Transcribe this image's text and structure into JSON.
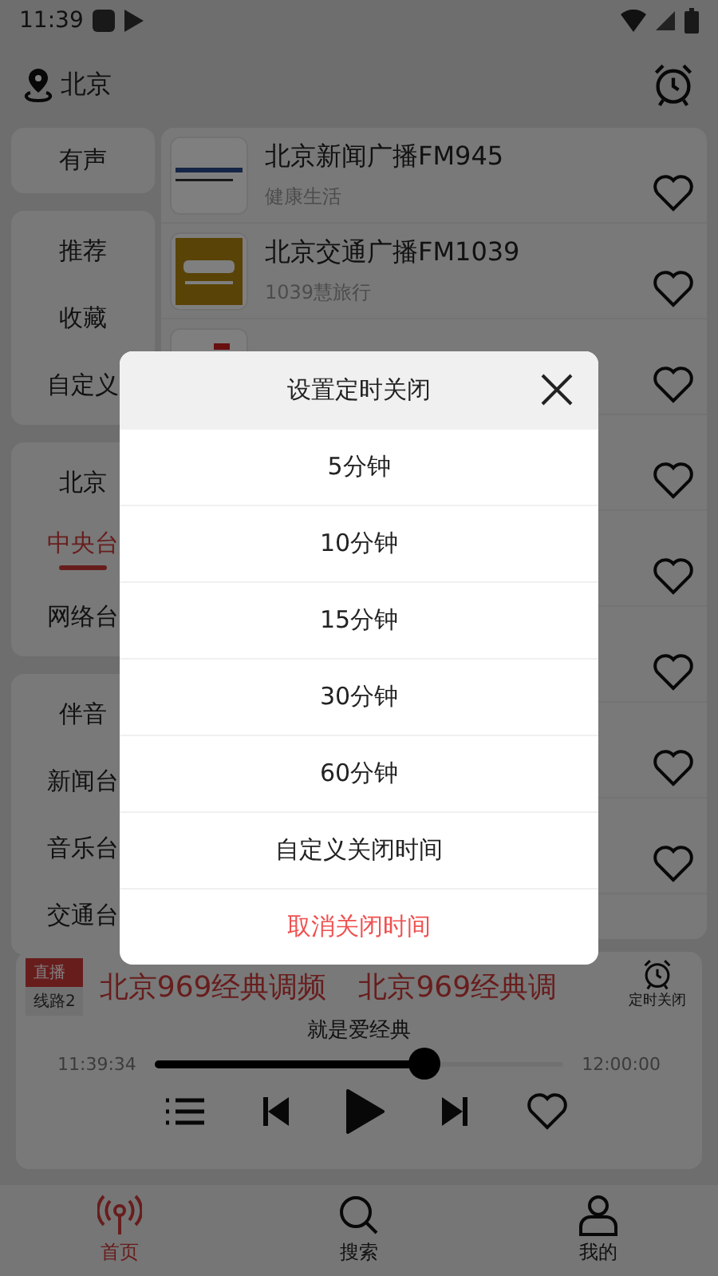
{
  "status_bar": {
    "time": "11:39"
  },
  "header": {
    "location": "北京"
  },
  "sidebar": {
    "groups": [
      {
        "items": [
          {
            "label": "有声",
            "selected": false
          }
        ]
      },
      {
        "items": [
          {
            "label": "推荐",
            "selected": false
          },
          {
            "label": "收藏",
            "selected": false
          },
          {
            "label": "自定义",
            "selected": false
          }
        ]
      },
      {
        "items": [
          {
            "label": "北京",
            "selected": false
          },
          {
            "label": "中央台",
            "selected": true
          },
          {
            "label": "网络台",
            "selected": false
          }
        ]
      },
      {
        "items": [
          {
            "label": "伴音",
            "selected": false
          },
          {
            "label": "新闻台",
            "selected": false
          },
          {
            "label": "音乐台",
            "selected": false
          },
          {
            "label": "交通台",
            "selected": false
          }
        ]
      }
    ]
  },
  "stations": [
    {
      "kind": "station",
      "name": "北京新闻广播FM945",
      "subtitle": "健康生活"
    },
    {
      "kind": "station",
      "name": "北京交通广播FM1039",
      "subtitle": "1039慧旅行"
    },
    {
      "kind": "partial"
    },
    {
      "kind": "covered"
    },
    {
      "kind": "covered"
    },
    {
      "kind": "covered"
    },
    {
      "kind": "covered"
    },
    {
      "kind": "covered"
    }
  ],
  "player": {
    "live_badge": "直播",
    "line_badge": "线路2",
    "titles": [
      "北京969经典调频",
      "北京969经典调"
    ],
    "timer_label": "定时关闭",
    "program": "就是爱经典",
    "start_time": "11:39:34",
    "end_time": "12:00:00",
    "level": 0.66
  },
  "bottom_nav": [
    {
      "label": "首页",
      "selected": true
    },
    {
      "label": "搜索",
      "selected": false
    },
    {
      "label": "我的",
      "selected": false
    }
  ],
  "dialog": {
    "title": "设置定时关闭",
    "options": [
      {
        "label": "5分钟",
        "kind": "normal"
      },
      {
        "label": "10分钟",
        "kind": "normal"
      },
      {
        "label": "15分钟",
        "kind": "normal"
      },
      {
        "label": "30分钟",
        "kind": "normal"
      },
      {
        "label": "60分钟",
        "kind": "normal"
      },
      {
        "label": "自定义关闭时间",
        "kind": "normal"
      },
      {
        "label": "取消关闭时间",
        "kind": "danger"
      }
    ]
  }
}
